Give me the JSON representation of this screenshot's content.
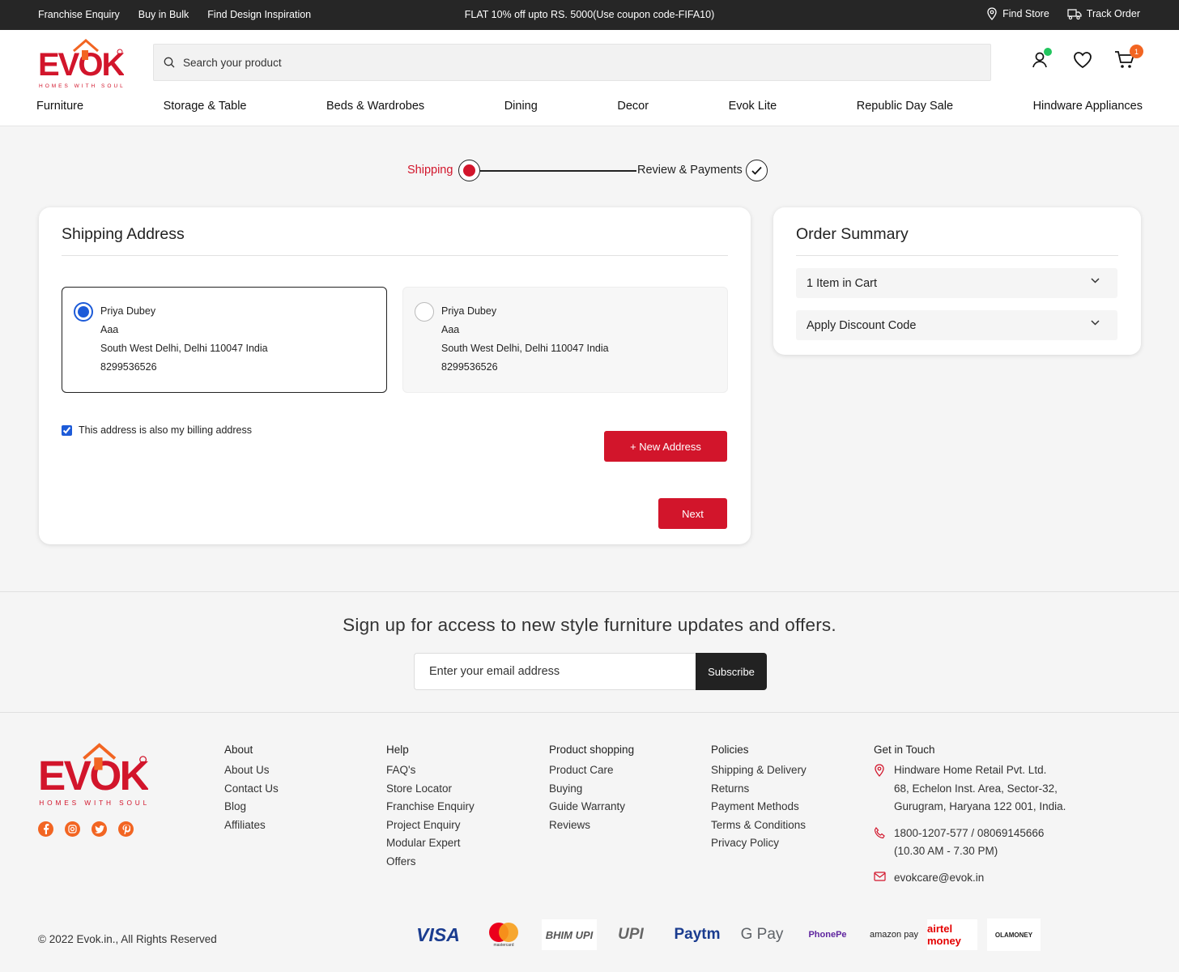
{
  "topbar": {
    "links": [
      "Franchise Enquiry",
      "Buy in Bulk",
      "Find Design Inspiration"
    ],
    "promo": "FLAT 10% off upto RS. 5000(Use coupon code-FIFA10)",
    "find_store": "Find Store",
    "track_order": "Track Order"
  },
  "header": {
    "logo_text": "EVOK",
    "logo_tagline": "HOMES WITH SOUL",
    "search_placeholder": "Search your product",
    "cart_count": "1",
    "nav": [
      "Furniture",
      "Storage & Table",
      "Beds & Wardrobes",
      "Dining",
      "Decor",
      "Evok Lite",
      "Republic Day Sale",
      "Hindware Appliances"
    ]
  },
  "stepper": {
    "step1": "Shipping",
    "step2": "Review & Payments"
  },
  "shipping": {
    "title": "Shipping Address",
    "addresses": [
      {
        "name": "Priya Dubey",
        "line1": "Aaa",
        "line2": "South West Delhi, Delhi 110047 India",
        "phone": "8299536526",
        "selected": true
      },
      {
        "name": "Priya Dubey",
        "line1": "Aaa",
        "line2": "South West Delhi, Delhi 110047 India",
        "phone": "8299536526",
        "selected": false
      }
    ],
    "billing_label": "This address is also my billing address",
    "new_address": "+ New Address",
    "next": "Next"
  },
  "summary": {
    "title": "Order Summary",
    "items": "1 Item in Cart",
    "discount": "Apply Discount Code"
  },
  "newsletter": {
    "title": "Sign up for access to new style furniture updates and offers.",
    "placeholder": "Enter your email address",
    "button": "Subscribe"
  },
  "footer": {
    "about": {
      "heading": "About",
      "links": [
        "About Us",
        "Contact Us",
        "Blog",
        "Affiliates"
      ]
    },
    "help": {
      "heading": "Help",
      "links": [
        "FAQ's",
        "Store Locator",
        "Franchise Enquiry",
        "Project Enquiry",
        "Modular Expert",
        "Offers"
      ]
    },
    "product": {
      "heading": "Product shopping",
      "links": [
        "Product Care",
        "Buying",
        "Guide Warranty",
        "Reviews"
      ]
    },
    "policies": {
      "heading": "Policies",
      "links": [
        "Shipping & Delivery",
        "Returns",
        "Payment Methods",
        "Terms & Conditions",
        "Privacy Policy"
      ]
    },
    "contact": {
      "heading": "Get in Touch",
      "address": [
        "Hindware Home Retail Pvt. Ltd.",
        "68, Echelon Inst. Area, Sector-32,",
        "Gurugram, Haryana 122 001, India."
      ],
      "phone": [
        "1800-1207-577 / 08069145666",
        "(10.30 AM - 7.30 PM)"
      ],
      "email": "evokcare@evok.in"
    },
    "copyright": "© 2022 Evok.in., All Rights Reserved",
    "payments": [
      "VISA",
      "mastercard",
      "BHIM UPI",
      "UPI",
      "Paytm",
      "G Pay",
      "PhonePe",
      "amazon pay",
      "airtel money",
      "OLAMONEY"
    ]
  },
  "colors": {
    "brand_red": "#d2152b",
    "accent_orange": "#f26522",
    "radio_blue": "#1d5bd8"
  }
}
